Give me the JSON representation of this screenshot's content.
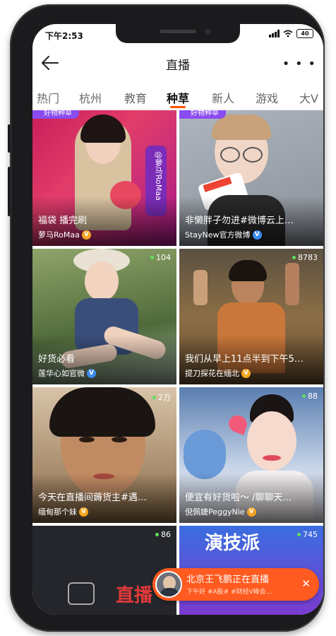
{
  "status": {
    "time": "下午2:53",
    "battery": "40"
  },
  "nav": {
    "title": "直播"
  },
  "tabs": [
    {
      "label": "热门"
    },
    {
      "label": "杭州"
    },
    {
      "label": "教育"
    },
    {
      "label": "种草"
    },
    {
      "label": "新人"
    },
    {
      "label": "游戏"
    },
    {
      "label": "大V"
    }
  ],
  "cards": [
    {
      "title": "福袋 播完刷",
      "author": "萝马RoMaa",
      "viewers": "",
      "tag": "好物种草",
      "sign": "@萝马RoMaa"
    },
    {
      "title": "非懒胖子勿进#微博云上…",
      "author": "StayNew官方微博",
      "viewers": "",
      "tag": "好物种草"
    },
    {
      "title": "好货必看",
      "author": "莲华心如官微",
      "viewers": "104"
    },
    {
      "title": "我们从早上11点半到下午5…",
      "author": "提刀探花在缅北",
      "viewers": "8783"
    },
    {
      "title": "今天在直播间薅货主#遇…",
      "author": "缅甸那个妹",
      "viewers": "2万"
    },
    {
      "title": "便宜有好货啦～ /聊聊天…",
      "author": "倪佩婕PeggyNie",
      "viewers": "88"
    },
    {
      "title": "",
      "author": "",
      "viewers": "86",
      "overlay": "直播"
    },
    {
      "title": "",
      "author": "",
      "viewers": "745",
      "overlay": "演技派"
    }
  ],
  "toast": {
    "title": "北京王飞鹏正在直播",
    "subtitle": "下午好 #A股# #财经V峰会…"
  }
}
